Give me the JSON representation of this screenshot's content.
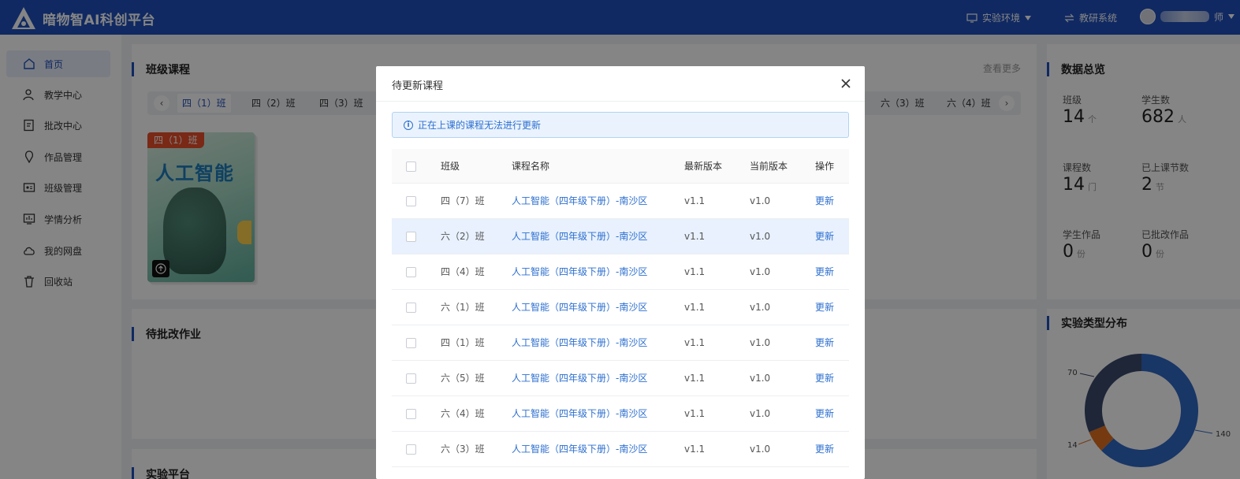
{
  "header": {
    "brand": "暗物智AI科创平台",
    "env_label": "实验环境",
    "research_label": "教研系统",
    "user_suffix": "师"
  },
  "sidebar": {
    "items": [
      {
        "label": "首页",
        "icon": "home-icon",
        "active": true
      },
      {
        "label": "教学中心",
        "icon": "teacher-icon"
      },
      {
        "label": "批改中心",
        "icon": "grading-icon"
      },
      {
        "label": "作品管理",
        "icon": "works-icon"
      },
      {
        "label": "班级管理",
        "icon": "class-icon"
      },
      {
        "label": "学情分析",
        "icon": "analytics-icon"
      },
      {
        "label": "我的网盘",
        "icon": "cloud-icon"
      },
      {
        "label": "回收站",
        "icon": "trash-icon"
      }
    ]
  },
  "courses_panel": {
    "title": "班级课程",
    "view_more": "查看更多",
    "tabs": [
      "四（1）班",
      "四（2）班",
      "四（3）班",
      "六（3）班",
      "六（4）班"
    ],
    "book": {
      "tag": "四（1）班",
      "title": "人工智能"
    }
  },
  "homework_panel": {
    "title": "待批改作业"
  },
  "lab_panel": {
    "title": "实验平台"
  },
  "overview": {
    "title": "数据总览",
    "stats": [
      {
        "label": "班级",
        "value": "14",
        "unit": "个"
      },
      {
        "label": "学生数",
        "value": "682",
        "unit": "人"
      },
      {
        "label": "课程数",
        "value": "14",
        "unit": "门"
      },
      {
        "label": "已上课节数",
        "value": "2",
        "unit": "节"
      },
      {
        "label": "学生作品",
        "value": "0",
        "unit": "份"
      },
      {
        "label": "已批改作品",
        "value": "0",
        "unit": "份"
      }
    ]
  },
  "lab_types": {
    "title": "实验类型分布",
    "donut": {
      "segments": [
        {
          "value": 140,
          "label": "140",
          "color": "#2f68c4"
        },
        {
          "value": 14,
          "label": "14",
          "color": "#e0701f"
        },
        {
          "value": 70,
          "label": "70",
          "color": "#3a4a6b"
        }
      ]
    }
  },
  "modal": {
    "title": "待更新课程",
    "notice": "正在上课的课程无法进行更新",
    "columns": {
      "class": "班级",
      "name": "课程名称",
      "latest": "最新版本",
      "current": "当前版本",
      "op": "操作"
    },
    "rows": [
      {
        "class": "四（7）班",
        "name": "人工智能（四年级下册）-南沙区",
        "latest": "v1.1",
        "current": "v1.0",
        "op": "更新"
      },
      {
        "class": "六（2）班",
        "name": "人工智能（四年级下册）-南沙区",
        "latest": "v1.1",
        "current": "v1.0",
        "op": "更新"
      },
      {
        "class": "四（4）班",
        "name": "人工智能（四年级下册）-南沙区",
        "latest": "v1.1",
        "current": "v1.0",
        "op": "更新"
      },
      {
        "class": "六（1）班",
        "name": "人工智能（四年级下册）-南沙区",
        "latest": "v1.1",
        "current": "v1.0",
        "op": "更新"
      },
      {
        "class": "四（1）班",
        "name": "人工智能（四年级下册）-南沙区",
        "latest": "v1.1",
        "current": "v1.0",
        "op": "更新"
      },
      {
        "class": "六（5）班",
        "name": "人工智能（四年级下册）-南沙区",
        "latest": "v1.1",
        "current": "v1.0",
        "op": "更新"
      },
      {
        "class": "六（4）班",
        "name": "人工智能（四年级下册）-南沙区",
        "latest": "v1.1",
        "current": "v1.0",
        "op": "更新"
      },
      {
        "class": "六（3）班",
        "name": "人工智能（四年级下册）-南沙区",
        "latest": "v1.1",
        "current": "v1.0",
        "op": "更新"
      }
    ]
  }
}
